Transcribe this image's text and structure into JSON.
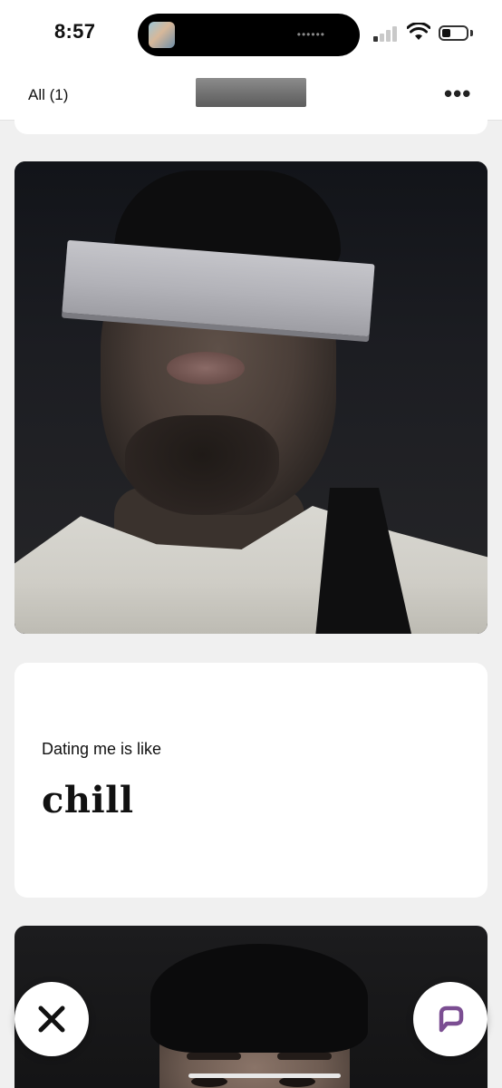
{
  "status_bar": {
    "time": "8:57",
    "icons": [
      "island-thumbnail",
      "cellular-signal-icon",
      "wifi-icon",
      "battery-icon"
    ]
  },
  "top_nav": {
    "filter_label": "All (1)",
    "more_icon": "more-horizontal-icon"
  },
  "profile": {
    "prompt": {
      "question": "Dating me is like",
      "answer": "chill"
    }
  },
  "actions": {
    "skip_icon": "x-icon",
    "like_icon": "comment-icon",
    "accent_color": "#7b4e92"
  }
}
